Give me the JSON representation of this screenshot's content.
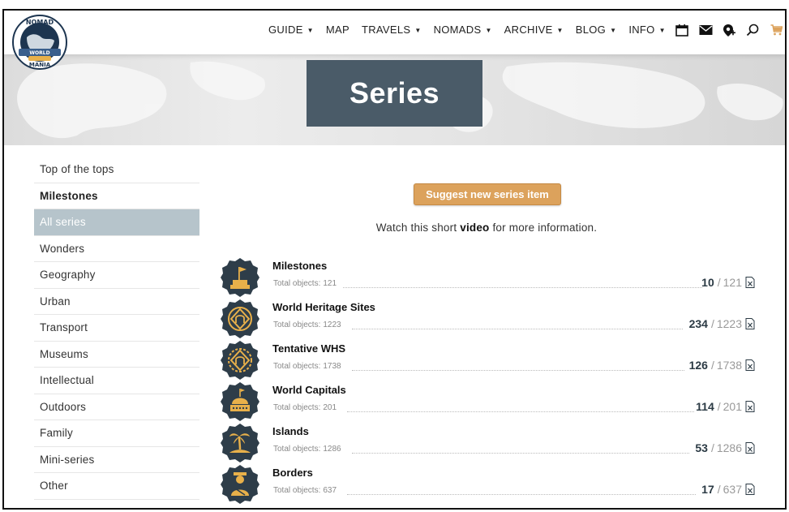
{
  "header": {
    "logo_text": [
      "NOMAD",
      "WORLD",
      "MANIA"
    ],
    "nav": [
      {
        "label": "GUIDE",
        "has_dropdown": true
      },
      {
        "label": "MAP",
        "has_dropdown": false
      },
      {
        "label": "TRAVELS",
        "has_dropdown": true
      },
      {
        "label": "NOMADS",
        "has_dropdown": true
      },
      {
        "label": "ARCHIVE",
        "has_dropdown": true
      },
      {
        "label": "BLOG",
        "has_dropdown": true
      },
      {
        "label": "INFO",
        "has_dropdown": true
      }
    ],
    "icons": [
      "calendar-icon",
      "mail-icon",
      "add-location-icon",
      "search-icon",
      "cart-icon"
    ],
    "cart_color": "#dca25c"
  },
  "hero": {
    "title": "Series",
    "box_color": "#4a5b68"
  },
  "sidebar": {
    "items": [
      {
        "label": "Top of the tops",
        "style": "normal"
      },
      {
        "label": "Milestones",
        "style": "bold"
      },
      {
        "label": "All series",
        "style": "active"
      },
      {
        "label": "Wonders",
        "style": "normal"
      },
      {
        "label": "Geography",
        "style": "normal"
      },
      {
        "label": "Urban",
        "style": "normal"
      },
      {
        "label": "Transport",
        "style": "normal"
      },
      {
        "label": "Museums",
        "style": "normal"
      },
      {
        "label": "Intellectual",
        "style": "normal"
      },
      {
        "label": "Outdoors",
        "style": "normal"
      },
      {
        "label": "Family",
        "style": "normal"
      },
      {
        "label": "Mini-series",
        "style": "normal"
      },
      {
        "label": "Other",
        "style": "normal"
      }
    ],
    "active_color": "#b6c4cb"
  },
  "main": {
    "suggest_button": "Suggest new series item",
    "watch_prefix": "Watch this short",
    "watch_link": "video",
    "watch_suffix": "for more information.",
    "series": [
      {
        "name": "Milestones",
        "total_label": "Total objects:",
        "total": "121",
        "done": "10",
        "icon": "milestone-flag-icon"
      },
      {
        "name": "World Heritage Sites",
        "total_label": "Total objects:",
        "total": "1223",
        "done": "234",
        "icon": "unesco-whs-icon"
      },
      {
        "name": "Tentative WHS",
        "total_label": "Total objects:",
        "total": "1738",
        "done": "126",
        "icon": "tentative-whs-icon"
      },
      {
        "name": "World Capitals",
        "total_label": "Total objects:",
        "total": "201",
        "done": "114",
        "icon": "capital-dome-icon"
      },
      {
        "name": "Islands",
        "total_label": "Total objects:",
        "total": "1286",
        "done": "53",
        "icon": "palm-island-icon"
      },
      {
        "name": "Borders",
        "total_label": "Total objects:",
        "total": "637",
        "done": "17",
        "icon": "border-guard-icon"
      }
    ],
    "badge_color": "#2e3d49",
    "badge_accent": "#e8b04a"
  }
}
